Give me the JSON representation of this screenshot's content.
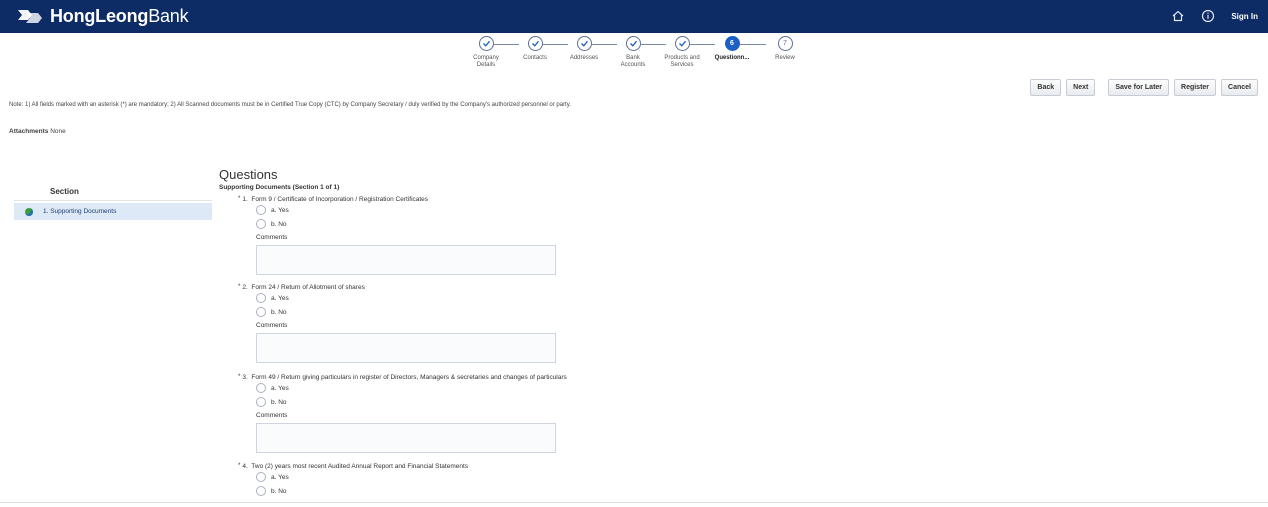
{
  "header": {
    "brand_bold": "HongLeong",
    "brand_light": "Bank",
    "sign_in": "Sign In",
    "icons": [
      "home-icon",
      "info-icon"
    ]
  },
  "train": {
    "steps": [
      {
        "label_lines": [
          "Company",
          "Details"
        ],
        "state": "done"
      },
      {
        "label_lines": [
          "Contacts"
        ],
        "state": "done"
      },
      {
        "label_lines": [
          "Addresses"
        ],
        "state": "done"
      },
      {
        "label_lines": [
          "Bank",
          "Accounts"
        ],
        "state": "done"
      },
      {
        "label_lines": [
          "Products and",
          "Services"
        ],
        "state": "done"
      },
      {
        "label_lines": [
          "Questionn..."
        ],
        "state": "active",
        "number": "6"
      },
      {
        "label_lines": [
          "Review"
        ],
        "state": "future",
        "number": "7"
      }
    ]
  },
  "buttons": {
    "back": "Back",
    "next": "Next",
    "save_later": "Save for Later",
    "register": "Register",
    "cancel": "Cancel"
  },
  "note": "Note: 1) All fields marked with an asterisk (*) are mandatory; 2) All Scanned documents must be in Certified True Copy (CTC) by Company Secretary / duly verified by the Company's authorized personnel or party.",
  "attachments": {
    "label": "Attachments",
    "value": "None"
  },
  "section_panel": {
    "header": "Section",
    "items": [
      {
        "label": "1. Supporting Documents"
      }
    ]
  },
  "questions": {
    "title": "Questions",
    "subtitle": "Supporting Documents (Section 1 of 1)",
    "items": [
      {
        "num": "1.",
        "text": "Form 9 / Certificate of Incorporation / Registration Certificates",
        "options": [
          "a. Yes",
          "b. No"
        ],
        "comments_label": "Comments"
      },
      {
        "num": "2.",
        "text": "Form 24 / Return of Allotment of shares",
        "options": [
          "a. Yes",
          "b. No"
        ],
        "comments_label": "Comments"
      },
      {
        "num": "3.",
        "text": "Form 49 / Return giving particulars in register of Directors, Managers & secretaries and changes of particulars",
        "options": [
          "a. Yes",
          "b. No"
        ],
        "comments_label": "Comments"
      },
      {
        "num": "4.",
        "text": "Two (2) years most recent Audited Annual Report and Financial Statements",
        "options": [
          "a. Yes",
          "b. No"
        ]
      }
    ]
  },
  "colors": {
    "header_bg": "#0d2b64",
    "active_step": "#1d5fc5",
    "section_highlight": "#dde9f7"
  }
}
